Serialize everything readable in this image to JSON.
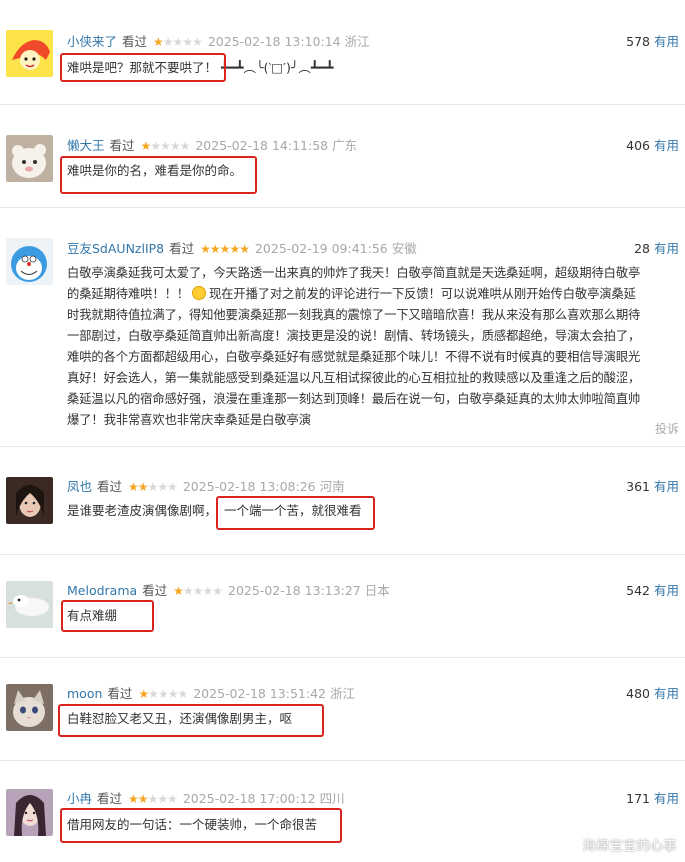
{
  "useful_label": "有用",
  "report_label": "投诉",
  "watermark": "海绵宝宝的心事",
  "comments": [
    {
      "user": "小侠来了",
      "seen": "看过",
      "rating": 1,
      "time": "2025-02-18 13:10:14",
      "location": "浙江",
      "votes": "578",
      "text": "难哄是吧？那就不要哄了！ ┻━┻︵╰(‵□′)╯︵┻━┻"
    },
    {
      "user": "懒大王",
      "seen": "看过",
      "rating": 1,
      "time": "2025-02-18 14:11:58",
      "location": "广东",
      "votes": "406",
      "text": "难哄是你的名，难看是你的命。"
    },
    {
      "user": "豆友SdAUNzlIP8",
      "seen": "看过",
      "rating": 5,
      "time": "2025-02-19 09:41:56",
      "location": "安徽",
      "votes": "28",
      "lines": [
        "白敬亭演桑延我可太爱了，今天路透一出来真的帅炸了我天！白敬亭简直就是天选桑延啊，超级期待白敬亭",
        "的桑延期待难哄！！！",
        "现在开播了对之前发的评论进行一下反馈！可以说难哄从刚开始传白敬亭演桑延",
        "时我就期待值拉满了，得知他要演桑延那一刻我真的震惊了一下又暗暗欣喜！我从来没有那么喜欢那么期待",
        "一部剧过，白敬亭桑延简直帅出新高度！演技更是没的说！剧情、转场镜头，质感都超绝，导演太会拍了，",
        "难哄的各个方面都超级用心，白敬亭桑延好有感觉就是桑延那个味儿！不得不说有时候真的要相信导演眼光",
        "真好！好会选人，第一集就能感受到桑延温以凡互相试探彼此的心互相拉扯的救赎感以及重逢之后的酸涩，",
        "桑延温以凡的宿命感好强，浪漫在重逢那一刻达到顶峰！最后在说一句，白敬亭桑延真的太帅太帅啦简直帅",
        "爆了！我非常喜欢也非常庆幸桑延是白敬亭演"
      ]
    },
    {
      "user": "凤也",
      "seen": "看过",
      "rating": 2,
      "time": "2025-02-18 13:08:26",
      "location": "河南",
      "votes": "361",
      "text_a": "是谁要老渣皮演偶像剧啊，",
      "text_b": "一个端一个苦，就很难看"
    },
    {
      "user": "Melodrama",
      "seen": "看过",
      "rating": 1,
      "time": "2025-02-18 13:13:27",
      "location": "日本",
      "votes": "542",
      "text": "有点难绷"
    },
    {
      "user": "moon",
      "seen": "看过",
      "rating": 1,
      "time": "2025-02-18 13:51:42",
      "location": "浙江",
      "votes": "480",
      "text": "白鞋怼脸又老又丑，还演偶像剧男主，呕"
    },
    {
      "user": "小冉",
      "seen": "看过",
      "rating": 2,
      "time": "2025-02-18 17:00:12",
      "location": "四川",
      "votes": "171",
      "text": "借用网友的一句话：一个硬装帅，一个命很苦"
    }
  ]
}
